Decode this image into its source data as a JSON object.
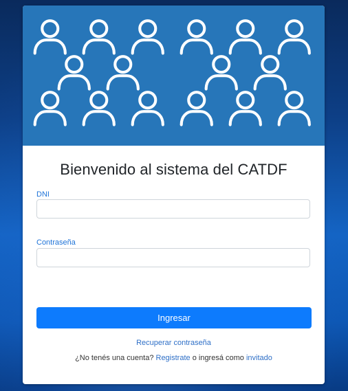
{
  "page": {
    "title": "Bienvenido al sistema del CATDF"
  },
  "form": {
    "dni_label": "DNI",
    "dni_value": "",
    "password_label": "Contraseña",
    "password_value": "",
    "submit_label": "Ingresar"
  },
  "links": {
    "recover": "Recuperar contraseña",
    "no_account_text": "¿No tenés una cuenta?",
    "register": "Registrate",
    "or_enter_as_text": "o ingresá como",
    "guest": "invitado"
  },
  "colors": {
    "banner": "#2776b9",
    "primary_button": "#0d7bfd",
    "label_text": "#1e73d8",
    "link": "#2e6fc7"
  },
  "icons": {
    "banner": "people-group-icon"
  }
}
